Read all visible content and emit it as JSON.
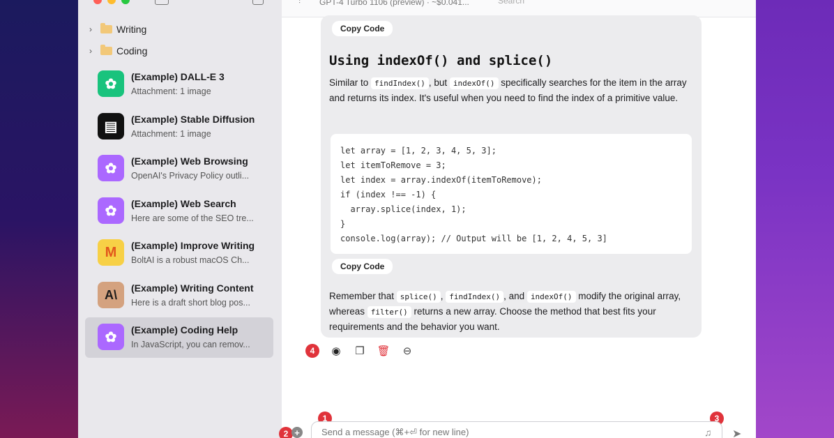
{
  "topbar": {
    "model": "GPT-4 Turbo 1106 (preview) · ~$0.041...",
    "search_placeholder": "Search"
  },
  "sidebar": {
    "folders": [
      {
        "label": "Writing"
      },
      {
        "label": "Coding"
      }
    ],
    "conversations": [
      {
        "title": "(Example) DALL-E 3",
        "subtitle": "Attachment: 1 image",
        "icon": "openai-icon",
        "color": "#19c37d",
        "selected": false
      },
      {
        "title": "(Example) Stable Diffusion",
        "subtitle": "Attachment: 1 image",
        "icon": "stability-icon",
        "color": "#111111",
        "selected": false
      },
      {
        "title": "(Example) Web Browsing",
        "subtitle": "OpenAI's Privacy Policy outli...",
        "icon": "openai-icon",
        "color": "#ab68ff",
        "selected": false
      },
      {
        "title": "(Example) Web Search",
        "subtitle": "Here are some of the SEO tre...",
        "icon": "openai-icon",
        "color": "#ab68ff",
        "selected": false
      },
      {
        "title": "(Example) Improve Writing",
        "subtitle": "BoltAI is a robust macOS Ch...",
        "icon": "mistral-icon",
        "color": "#f7d046",
        "selected": false
      },
      {
        "title": "(Example) Writing Content",
        "subtitle": "Here is a draft short blog pos...",
        "icon": "anthropic-icon",
        "color": "#d4a27f",
        "selected": false
      },
      {
        "title": "(Example) Coding Help",
        "subtitle": "In JavaScript, you can remov...",
        "icon": "openai-icon",
        "color": "#ab68ff",
        "selected": true
      }
    ]
  },
  "message": {
    "copy_code_label": "Copy Code",
    "heading_code": "Using indexOf() and splice()",
    "para1": {
      "t1": "Similar to ",
      "c1": "findIndex()",
      "t2": ", but ",
      "c2": "indexOf()",
      "t3": " specifically searches for the item in the array and returns its index. It's useful when you need to find the index of a primitive value."
    },
    "code_lines": [
      "let array = [1, 2, 3, 4, 5, 3];",
      "let itemToRemove = 3;",
      "let index = array.indexOf(itemToRemove);",
      "if (index !== -1) {",
      "  array.splice(index, 1);",
      "}",
      "console.log(array); // Output will be [1, 2, 4, 5, 3]"
    ],
    "para2": {
      "t1": "Remember that ",
      "c1": "splice()",
      "t2": ", ",
      "c2": "findIndex()",
      "t3": ", and ",
      "c3": "indexOf()",
      "t4": " modify the original array, whereas ",
      "c4": "filter()",
      "t5": " returns a new array. Choose the method that best fits your requirements and the behavior you want."
    }
  },
  "actions": {
    "badge": "4"
  },
  "composer": {
    "placeholder": "Send a message (⌘+⏎ for new line)",
    "badge1": "1",
    "badge2": "2",
    "badge3": "3"
  },
  "colors": {
    "accent_red": "#e0333b",
    "selected_bg": "#d3d2d8"
  }
}
